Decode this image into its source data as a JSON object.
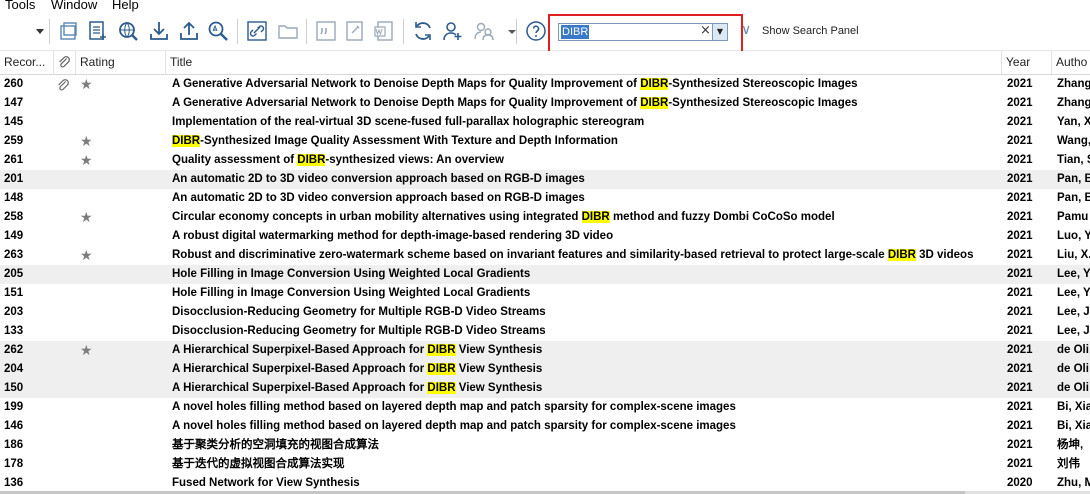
{
  "menu": {
    "items": [
      "Tools",
      "Window",
      "Help"
    ]
  },
  "search": {
    "value": "DIBR",
    "clear_symbol": "×",
    "dropdown_symbol": "▼"
  },
  "show_search_panel": {
    "label": "Show Search Panel",
    "chevron": "∨"
  },
  "columns": {
    "record": "Recor...",
    "attach": "",
    "rating": "Rating",
    "title": "Title",
    "year": "Year",
    "author": "Autho"
  },
  "highlight_term": "DIBR",
  "colors": {
    "highlight": "#ffff00",
    "red_box": "#e02020",
    "selection": "#3a78c8"
  },
  "rows": [
    {
      "record": "260",
      "attach": true,
      "star": true,
      "title": "A Generative Adversarial Network to Denoise Depth Maps for Quality Improvement of DIBR-Synthesized Stereoscopic Images",
      "year": "2021",
      "author": "Zhang"
    },
    {
      "record": "147",
      "attach": false,
      "star": false,
      "title": "A Generative Adversarial Network to Denoise Depth Maps for Quality Improvement of DIBR-Synthesized Stereoscopic Images",
      "year": "2021",
      "author": "Zhang"
    },
    {
      "record": "145",
      "attach": false,
      "star": false,
      "title": "Implementation of the real-virtual 3D scene-fused full-parallax holographic stereogram",
      "year": "2021",
      "author": "Yan, X"
    },
    {
      "record": "259",
      "attach": false,
      "star": true,
      "title": "DIBR-Synthesized Image Quality Assessment With Texture and Depth Information",
      "year": "2021",
      "author": "Wang,"
    },
    {
      "record": "261",
      "attach": false,
      "star": true,
      "title": "Quality assessment of DIBR-synthesized views: An overview",
      "year": "2021",
      "author": "Tian, S"
    },
    {
      "record": "201",
      "attach": false,
      "star": false,
      "title": "An automatic 2D to 3D video conversion approach based on RGB-D images",
      "year": "2021",
      "author": "Pan, B"
    },
    {
      "record": "148",
      "attach": false,
      "star": false,
      "title": "An automatic 2D to 3D video conversion approach based on RGB-D images",
      "year": "2021",
      "author": "Pan, B"
    },
    {
      "record": "258",
      "attach": false,
      "star": true,
      "title": "Circular economy concepts in urban mobility alternatives using integrated DIBR method and fuzzy Dombi CoCoSo model",
      "year": "2021",
      "author": "Pamu"
    },
    {
      "record": "149",
      "attach": false,
      "star": false,
      "title": "A robust digital watermarking method for depth-image-based rendering 3D video",
      "year": "2021",
      "author": "Luo, Y"
    },
    {
      "record": "263",
      "attach": false,
      "star": true,
      "title": "Robust and discriminative zero-watermark scheme based on invariant features and similarity-based retrieval to protect large-scale DIBR 3D videos",
      "year": "2021",
      "author": "Liu, X."
    },
    {
      "record": "205",
      "attach": false,
      "star": false,
      "title": "Hole Filling in Image Conversion Using Weighted Local Gradients",
      "year": "2021",
      "author": "Lee, Y"
    },
    {
      "record": "151",
      "attach": false,
      "star": false,
      "title": "Hole Filling in Image Conversion Using Weighted Local Gradients",
      "year": "2021",
      "author": "Lee, Y"
    },
    {
      "record": "203",
      "attach": false,
      "star": false,
      "title": "Disocclusion-Reducing Geometry for Multiple RGB-D Video Streams",
      "year": "2021",
      "author": "Lee, J"
    },
    {
      "record": "133",
      "attach": false,
      "star": false,
      "title": "Disocclusion-Reducing Geometry for Multiple RGB-D Video Streams",
      "year": "2021",
      "author": "Lee, J"
    },
    {
      "record": "262",
      "attach": false,
      "star": true,
      "title": "A Hierarchical Superpixel-Based Approach for DIBR View Synthesis",
      "year": "2021",
      "author": "de Oli"
    },
    {
      "record": "204",
      "attach": false,
      "star": false,
      "title": "A Hierarchical Superpixel-Based Approach for DIBR View Synthesis",
      "year": "2021",
      "author": "de Oli"
    },
    {
      "record": "150",
      "attach": false,
      "star": false,
      "title": "A Hierarchical Superpixel-Based Approach for DIBR View Synthesis",
      "year": "2021",
      "author": "de Oli"
    },
    {
      "record": "199",
      "attach": false,
      "star": false,
      "title": "A novel holes filling method based on layered depth map and patch sparsity for complex-scene images",
      "year": "2021",
      "author": "Bi, Xia"
    },
    {
      "record": "146",
      "attach": false,
      "star": false,
      "title": "A novel holes filling method based on layered depth map and patch sparsity for complex-scene images",
      "year": "2021",
      "author": "Bi, Xia"
    },
    {
      "record": "186",
      "attach": false,
      "star": false,
      "title": "基于聚类分析的空洞填充的视图合成算法",
      "year": "2021",
      "author": "杨坤,"
    },
    {
      "record": "178",
      "attach": false,
      "star": false,
      "title": "基于迭代的虚拟视图合成算法实现",
      "year": "2021",
      "author": "刘伟"
    },
    {
      "record": "136",
      "attach": false,
      "star": false,
      "title": "Fused Network for View Synthesis",
      "year": "2020",
      "author": "Zhu, M"
    }
  ]
}
